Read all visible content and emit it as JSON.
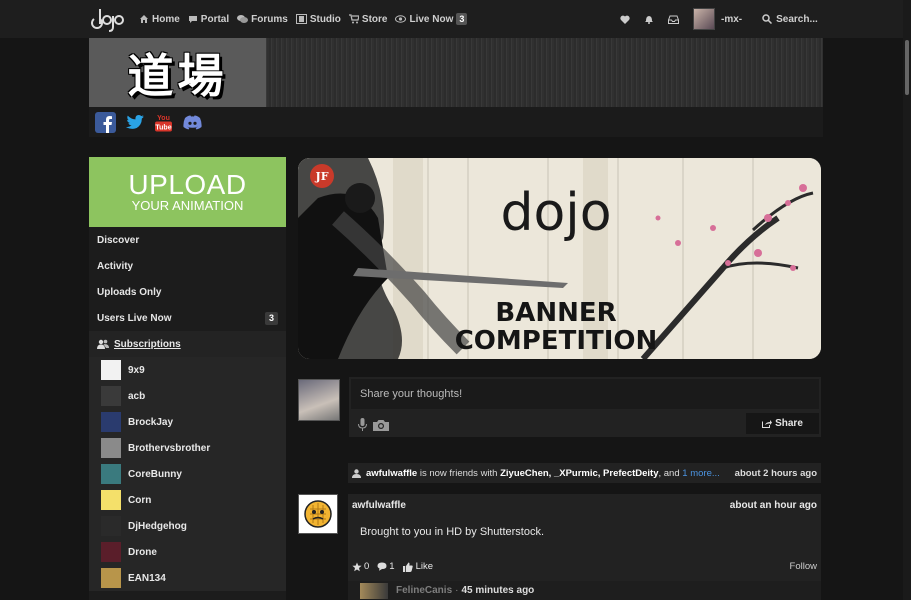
{
  "nav": {
    "items": [
      {
        "label": "Home",
        "icon": "home-icon"
      },
      {
        "label": "Portal",
        "icon": "chat-icon"
      },
      {
        "label": "Forums",
        "icon": "comments-icon"
      },
      {
        "label": "Studio",
        "icon": "film-icon"
      },
      {
        "label": "Store",
        "icon": "cart-icon"
      },
      {
        "label": "Live Now",
        "icon": "eye-icon"
      }
    ],
    "live_count": "3",
    "user_name": "-mx-",
    "search_label": "Search..."
  },
  "header": {
    "kanji": "道場"
  },
  "sidebar": {
    "upload_big": "UPLOAD",
    "upload_small": "YOUR ANIMATION",
    "links": [
      {
        "label": "Discover"
      },
      {
        "label": "Activity"
      },
      {
        "label": "Uploads Only"
      },
      {
        "label": "Users Live Now",
        "count": "3"
      }
    ],
    "subscriptions_label": "Subscriptions",
    "subscriptions": [
      {
        "name": "9x9",
        "color": "#f2f2f2"
      },
      {
        "name": "acb",
        "color": "#3a3a3a"
      },
      {
        "name": "BrockJay",
        "color": "#2a3b6e"
      },
      {
        "name": "Brothervsbrother",
        "color": "#8a8a8a"
      },
      {
        "name": "CoreBunny",
        "color": "#3a7a7e"
      },
      {
        "name": "Corn",
        "color": "#f4e06a"
      },
      {
        "name": "DjHedgehog",
        "color": "#2a2a2a"
      },
      {
        "name": "Drone",
        "color": "#5a1e2a"
      },
      {
        "name": "EAN134",
        "color": "#b8954a"
      }
    ]
  },
  "banner": {
    "logo": "dojo",
    "line1": "BANNER",
    "line2": "COMPETITION",
    "stamp": "JF"
  },
  "composer": {
    "placeholder": "Share your thoughts!",
    "share_label": "Share"
  },
  "activity": {
    "user": "awfulwaffle",
    "text_mid": " is now friends with ",
    "friends": "ZiyueChen, _XPurmic, PrefectDeity",
    "and": ", and ",
    "more": "1 more...",
    "time": "about 2 hours ago"
  },
  "post": {
    "user": "awfulwaffle",
    "time": "about an hour ago",
    "message": "Brought to you in HD by Shutterstock.",
    "stars": "0",
    "comments": "1",
    "like_label": "Like",
    "follow_label": "Follow"
  },
  "comment": {
    "user": "FelineCanis",
    "separator": "·",
    "time": "45 minutes ago"
  }
}
